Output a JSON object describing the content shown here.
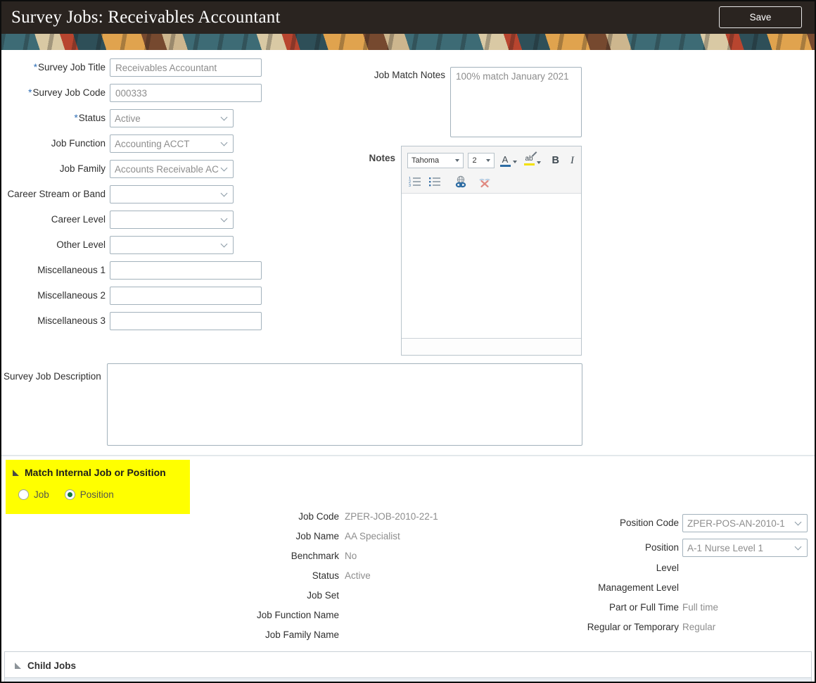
{
  "header": {
    "title": "Survey Jobs: Receivables Accountant",
    "save_label": "Save"
  },
  "colors": {
    "header_bg": "#2a2420",
    "highlight_yellow": "#ffff00",
    "radio_selected_green": "#157a33",
    "required_asterisk_blue": "#2d6db5"
  },
  "form_left": {
    "fields": [
      {
        "label": "Survey Job Title",
        "required_mark": "*",
        "value": "Receivables Accountant",
        "type": "text"
      },
      {
        "label": "Survey Job Code",
        "required_mark": "*",
        "value": "000333",
        "type": "text"
      },
      {
        "label": "Status",
        "required_mark": "*",
        "value": "Active",
        "type": "select"
      },
      {
        "label": "Job Function",
        "required_mark": "",
        "value": "Accounting ACCT",
        "type": "select"
      },
      {
        "label": "Job Family",
        "required_mark": "",
        "value": "Accounts Receivable AC",
        "type": "select"
      },
      {
        "label": "Career Stream or Band",
        "required_mark": "",
        "value": "",
        "type": "select"
      },
      {
        "label": "Career Level",
        "required_mark": "",
        "value": "",
        "type": "select"
      },
      {
        "label": "Other Level",
        "required_mark": "",
        "value": "",
        "type": "select"
      },
      {
        "label": "Miscellaneous 1",
        "required_mark": "",
        "value": "",
        "type": "text"
      },
      {
        "label": "Miscellaneous 2",
        "required_mark": "",
        "value": "",
        "type": "text"
      },
      {
        "label": "Miscellaneous 3",
        "required_mark": "",
        "value": "",
        "type": "text"
      }
    ]
  },
  "job_match_notes": {
    "label": "Job Match Notes",
    "value": "100% match January 2021"
  },
  "notes_editor": {
    "label": "Notes",
    "font_family": "Tahoma",
    "font_size": "2",
    "bold_label": "B",
    "italic_label": "I",
    "font_color_letter": "A",
    "highlight_letters": "ab"
  },
  "survey_job_description": {
    "label": "Survey Job Description",
    "value": ""
  },
  "match_section": {
    "title": "Match Internal Job or Position",
    "radio_job_label": "Job",
    "radio_position_label": "Position",
    "selected": "Position"
  },
  "job_details": {
    "rows": [
      {
        "label": "Job Code",
        "value": "ZPER-JOB-2010-22-1"
      },
      {
        "label": "Job Name",
        "value": "AA Specialist"
      },
      {
        "label": "Benchmark",
        "value": "No"
      },
      {
        "label": "Status",
        "value": "Active"
      },
      {
        "label": "Job Set",
        "value": ""
      },
      {
        "label": "Job Function Name",
        "value": ""
      },
      {
        "label": "Job Family Name",
        "value": ""
      }
    ]
  },
  "position_details": {
    "position_code": {
      "label": "Position Code",
      "value": "ZPER-POS-AN-2010-1"
    },
    "position": {
      "label": "Position",
      "value": "A-1 Nurse Level 1"
    },
    "rows": [
      {
        "label": "Level",
        "value": ""
      },
      {
        "label": "Management Level",
        "value": ""
      },
      {
        "label": "Part or Full Time",
        "value": "Full time"
      },
      {
        "label": "Regular or Temporary",
        "value": "Regular"
      }
    ]
  },
  "child_jobs": {
    "title": "Child Jobs"
  }
}
